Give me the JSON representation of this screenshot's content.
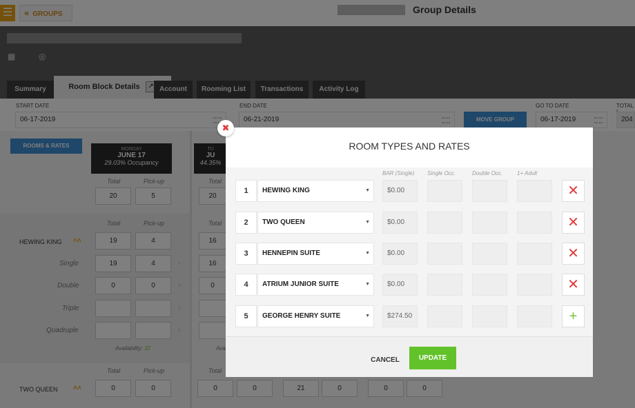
{
  "topbar": {
    "menu_icon": "menu-icon",
    "back_label": "GROUPS",
    "title": "Group Details"
  },
  "tabs": [
    {
      "label": "Summary"
    },
    {
      "label": "Room Block Details"
    },
    {
      "label": "Account"
    },
    {
      "label": "Rooming List"
    },
    {
      "label": "Transactions"
    },
    {
      "label": "Activity Log"
    }
  ],
  "fields": {
    "start_date": {
      "label": "START DATE",
      "value": "06-17-2019"
    },
    "end_date": {
      "label": "END DATE",
      "value": "06-21-2019"
    },
    "move_group": "MOVE GROUP",
    "go_to_date": {
      "label": "GO TO DATE",
      "value": "06-17-2019"
    },
    "total": {
      "label": "TOTAL I",
      "value": "204"
    }
  },
  "grid": {
    "rooms_rates_btn": "ROOMS & RATES",
    "day1": {
      "weekday": "MONDAY",
      "date": "JUNE 17",
      "occupancy": "29.03% Occupancy"
    },
    "day2": {
      "weekday": "TU",
      "date": "JU",
      "occupancy": "44.35%"
    },
    "total_label": "Total",
    "pickup_label": "Pick-up",
    "summary": {
      "total": "20",
      "pickup": "5",
      "total2": "20"
    },
    "hewing": {
      "name": "HEWING KING",
      "total": "19",
      "pickup": "4",
      "total2": "16"
    },
    "single": {
      "label": "Single",
      "total": "19",
      "pickup": "4",
      "total2": "16"
    },
    "double": {
      "label": "Double",
      "total": "0",
      "pickup": "0",
      "total2": "0"
    },
    "triple": {
      "label": "Triple"
    },
    "quadruple": {
      "label": "Quadruple"
    },
    "availability": {
      "label": "Availability:",
      "value": "32",
      "label2": "Avai"
    },
    "two_queen": {
      "name": "TWO QUEEN",
      "total": "0",
      "pickup": "0",
      "total2": "0",
      "pickup2": "0",
      "c3": "21",
      "c4": "0",
      "c5": "0",
      "c6": "0"
    }
  },
  "modal": {
    "title": "ROOM TYPES AND RATES",
    "col_bar": "BAR (Single)",
    "col_single": "Single Occ.",
    "col_double": "Double Occ.",
    "col_adult": "1+ Adult",
    "rows": [
      {
        "num": "1",
        "room": "HEWING KING",
        "bar": "$0.00"
      },
      {
        "num": "2",
        "room": "TWO QUEEN",
        "bar": "$0.00"
      },
      {
        "num": "3",
        "room": "HENNEPIN SUITE",
        "bar": "$0.00"
      },
      {
        "num": "4",
        "room": "ATRIUM JUNIOR SUITE",
        "bar": "$0.00"
      },
      {
        "num": "5",
        "room": "GEORGE HENRY SUITE",
        "bar": "$274.50"
      }
    ],
    "cancel": "CANCEL",
    "update": "UPDATE"
  },
  "colors": {
    "accent_orange": "#e8a317",
    "button_blue": "#3d8ed4",
    "update_green": "#62c22a",
    "delete_red": "#e03a3a"
  }
}
